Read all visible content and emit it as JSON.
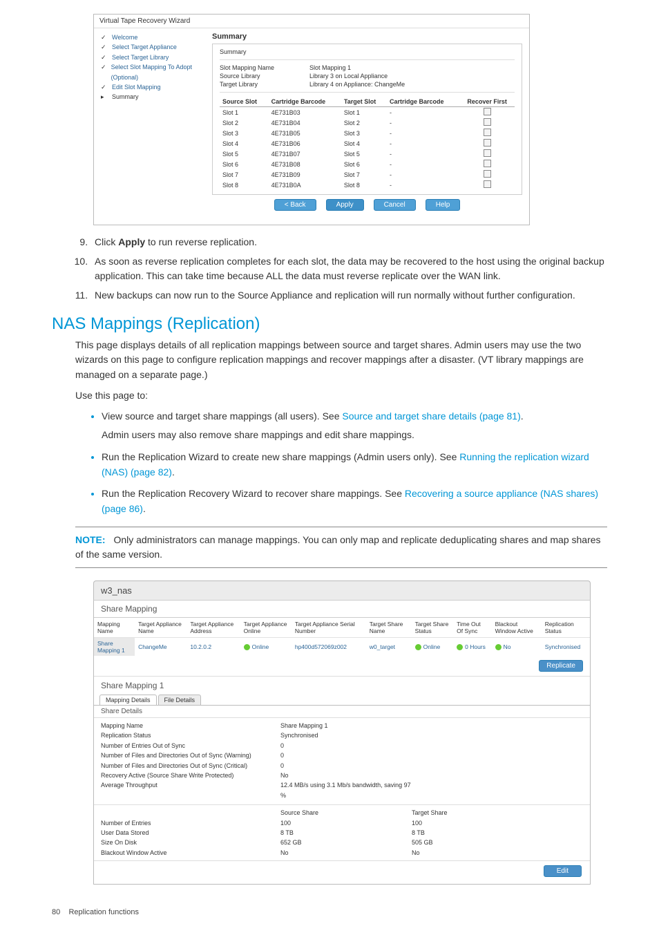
{
  "wizard": {
    "title": "Virtual Tape Recovery Wizard",
    "steps": [
      "Welcome",
      "Select Target Appliance",
      "Select Target Library",
      "Select Slot Mapping To Adopt (Optional)",
      "Edit Slot Mapping",
      "Summary"
    ],
    "section_title": "Summary",
    "box_label": "Summary",
    "kv": [
      {
        "k": "Slot Mapping Name",
        "v": "Slot Mapping 1"
      },
      {
        "k": "Source Library",
        "v": "Library 3 on Local Appliance"
      },
      {
        "k": "Target Library",
        "v": "Library 4 on Appliance: ChangeMe"
      }
    ],
    "cols": [
      "Source Slot",
      "Cartridge Barcode",
      "Target Slot",
      "Cartridge Barcode",
      "Recover First"
    ],
    "rows": [
      [
        "Slot 1",
        "4E731B03",
        "Slot 1",
        "-",
        false
      ],
      [
        "Slot 2",
        "4E731B04",
        "Slot 2",
        "-",
        false
      ],
      [
        "Slot 3",
        "4E731B05",
        "Slot 3",
        "-",
        false
      ],
      [
        "Slot 4",
        "4E731B06",
        "Slot 4",
        "-",
        false
      ],
      [
        "Slot 5",
        "4E731B07",
        "Slot 5",
        "-",
        false
      ],
      [
        "Slot 6",
        "4E731B08",
        "Slot 6",
        "-",
        false
      ],
      [
        "Slot 7",
        "4E731B09",
        "Slot 7",
        "-",
        false
      ],
      [
        "Slot 8",
        "4E731B0A",
        "Slot 8",
        "-",
        false
      ]
    ],
    "buttons": {
      "back": "< Back",
      "apply": "Apply",
      "cancel": "Cancel",
      "help": "Help"
    }
  },
  "steps_ol": [
    "run_apply",
    "step10",
    "step11"
  ],
  "steps_text": {
    "apply_pre": "Click ",
    "apply_bold": "Apply",
    "apply_post": " to run reverse replication.",
    "ten": "As soon as reverse replication completes for each slot, the data may be recovered to the host using the original backup application. This can take time because ALL the data must reverse replicate over the WAN link.",
    "eleven": "New backups can now run to the Source Appliance and replication will run normally without further configuration."
  },
  "section": {
    "title": "NAS Mappings (Replication)",
    "p1": "This page displays details of all replication mappings between source and target shares. Admin users may use the two wizards on this page to configure replication mappings and recover mappings after a disaster. (VT library mappings are managed on a separate page.)",
    "p2": "Use this page to:",
    "bullets": [
      {
        "pre": "View source and target share mappings (all users). See ",
        "link": "Source and target share details (page 81)",
        "post": ".",
        "sub": "Admin users may also remove share mappings and edit share mappings."
      },
      {
        "pre": "Run the Replication Wizard to create new share mappings (Admin users only). See ",
        "link": "Running the replication wizard (NAS) (page 82)",
        "post": "."
      },
      {
        "pre": "Run the Replication Recovery Wizard to recover share mappings. See ",
        "link": "Recovering a source appliance (NAS shares) (page 86)",
        "post": "."
      }
    ],
    "note_label": "NOTE:",
    "note": "Only administrators can manage mappings. You can only map and replicate deduplicating shares and map shares of the same version."
  },
  "fig2": {
    "title": "w3_nas",
    "share_mapping": "Share Mapping",
    "cols": [
      "Mapping Name",
      "Target Appliance Name",
      "Target Appliance Address",
      "Target Appliance Online",
      "Target Appliance Serial Number",
      "Target Share Name",
      "Target Share Status",
      "Time Out Of Sync",
      "Blackout Window Active",
      "Replication Status"
    ],
    "row": [
      "Share Mapping 1",
      "ChangeMe",
      "10.2.0.2",
      "Online",
      "hp400d572069z002",
      "w0_target",
      "Online",
      "0 Hours",
      "No",
      "Synchronised"
    ],
    "replicate_btn": "Replicate",
    "sm1_title": "Share Mapping 1",
    "tabs": [
      "Mapping Details",
      "File Details"
    ],
    "sd_label": "Share Details",
    "details": [
      {
        "k": "Mapping Name",
        "v": "Share Mapping 1"
      },
      {
        "k": "Replication Status",
        "v": "Synchronised"
      },
      {
        "k": "Number of Entries Out of Sync",
        "v": "0"
      },
      {
        "k": "Number of Files and Directories Out of Sync (Warning)",
        "v": "0"
      },
      {
        "k": "Number of Files and Directories Out of Sync (Critical)",
        "v": "0"
      },
      {
        "k": "Recovery Active (Source Share Write Protected)",
        "v": "No"
      },
      {
        "k": "Average Throughput",
        "v": "12.4 MB/s using 3.1 Mb/s bandwidth, saving 97 %"
      }
    ],
    "cmp_header": [
      "",
      "Source Share",
      "Target Share"
    ],
    "cmp_rows": [
      {
        "k": "Number of Entries",
        "s": "100",
        "t": "100"
      },
      {
        "k": "User Data Stored",
        "s": "8 TB",
        "t": "8 TB"
      },
      {
        "k": "Size On Disk",
        "s": "652 GB",
        "t": "505 GB"
      },
      {
        "k": "Blackout Window Active",
        "s": "No",
        "t": "No"
      }
    ],
    "edit_btn": "Edit"
  },
  "footer": {
    "page": "80",
    "section": "Replication functions"
  }
}
